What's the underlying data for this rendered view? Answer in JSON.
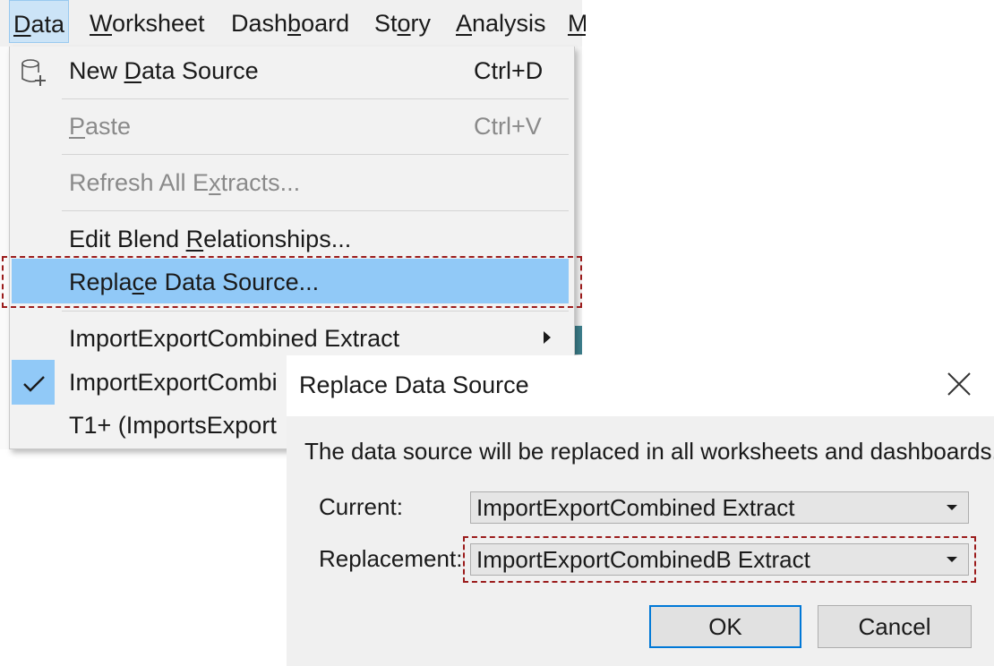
{
  "menubar": {
    "items": [
      {
        "label": "Data",
        "accel": "D",
        "rest": "ata",
        "active": true
      },
      {
        "label": "Worksheet",
        "accel": "W",
        "rest": "orksheet"
      },
      {
        "label": "Dashboard",
        "pre": "Dash",
        "accel": "b",
        "rest": "oard"
      },
      {
        "label": "Story",
        "pre": "St",
        "accel": "o",
        "rest": "ry"
      },
      {
        "label": "Analysis",
        "accel": "A",
        "rest": "nalysis"
      },
      {
        "label": "M",
        "accel": "M"
      }
    ]
  },
  "data_menu": {
    "new_data_source": {
      "pre": "New ",
      "accel": "D",
      "rest": "ata Source",
      "shortcut": "Ctrl+D",
      "icon": "new-datasource-icon"
    },
    "paste": {
      "pre": "",
      "accel": "P",
      "rest": "aste",
      "shortcut": "Ctrl+V",
      "disabled": true
    },
    "refresh_all_extracts": {
      "pre": "Refresh All E",
      "accel": "x",
      "rest": "tracts...",
      "disabled": true
    },
    "edit_blend_relationships": {
      "pre": "Edit Blend ",
      "accel": "R",
      "rest": "elationships..."
    },
    "replace_data_source": {
      "pre": "Repla",
      "accel": "c",
      "rest": "e Data Source...",
      "highlighted": true
    },
    "datasources": [
      {
        "label": "ImportExportCombined Extract",
        "has_submenu": true
      },
      {
        "label": "ImportExportCombi",
        "checked": true
      },
      {
        "label": "T1+ (ImportsExport"
      }
    ]
  },
  "dialog": {
    "title": "Replace Data Source",
    "message": "The data source will be replaced in all worksheets and dashboards.",
    "current_label": "Current:",
    "current_value": "ImportExportCombined Extract",
    "replacement_label": "Replacement:",
    "replacement_value": "ImportExportCombinedB Extract",
    "ok_label": "OK",
    "cancel_label": "Cancel"
  },
  "colors": {
    "highlight": "#91c9f7",
    "annotation_dash": "#9b1c1c",
    "default_button_border": "#0078d7"
  }
}
